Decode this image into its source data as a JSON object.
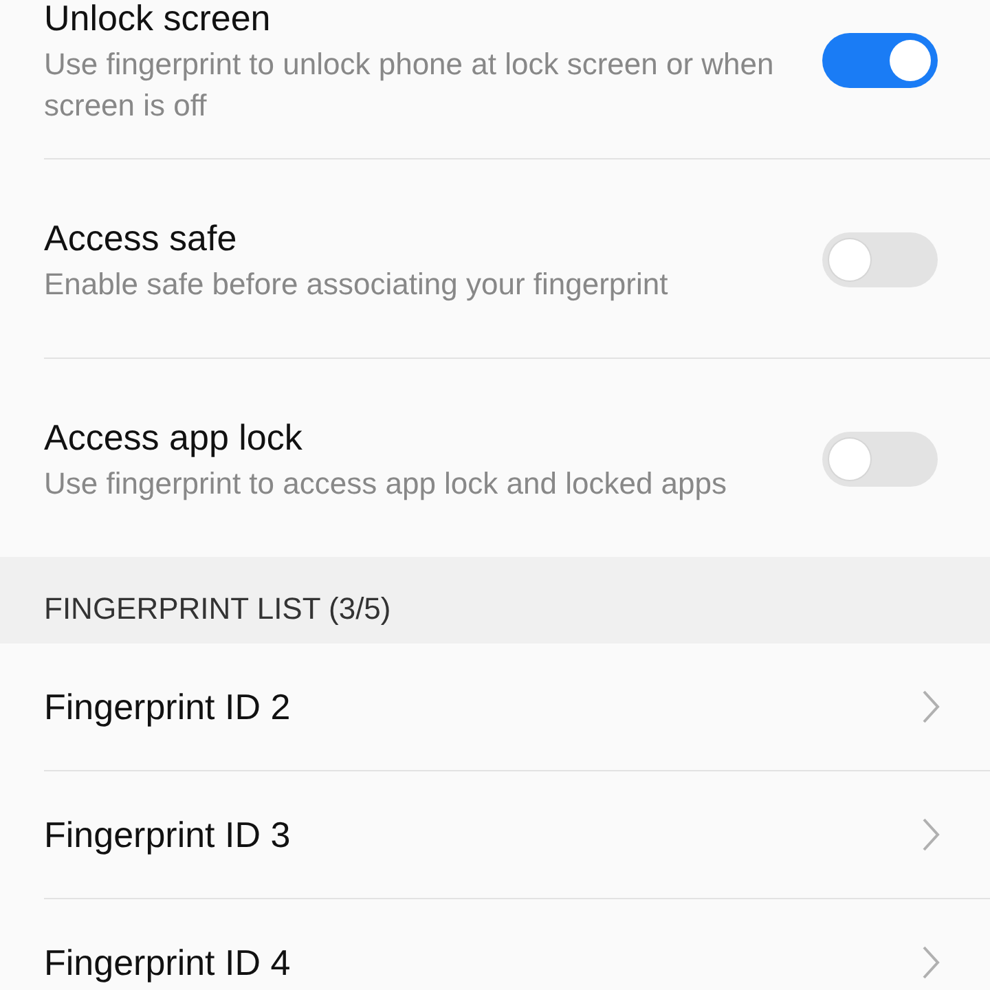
{
  "settings": [
    {
      "title": "Unlock screen",
      "subtitle": "Use fingerprint to unlock phone at lock screen or when screen is off",
      "on": true
    },
    {
      "title": "Access safe",
      "subtitle": "Enable safe before associating your fingerprint",
      "on": false
    },
    {
      "title": "Access app lock",
      "subtitle": "Use fingerprint to access app lock and locked apps",
      "on": false
    }
  ],
  "fingerprint_list": {
    "header": "FINGERPRINT LIST (3/5)",
    "items": [
      "Fingerprint ID 2",
      "Fingerprint ID 3",
      "Fingerprint ID 4"
    ]
  }
}
